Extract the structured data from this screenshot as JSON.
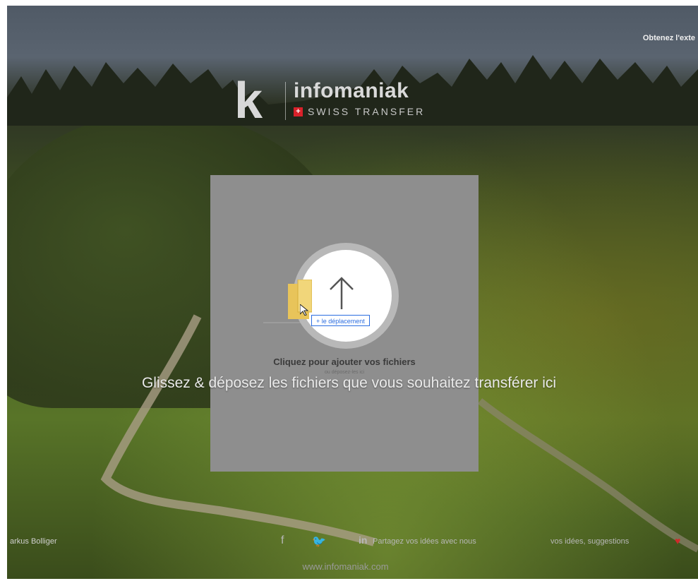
{
  "header": {
    "brand_letter": "k",
    "brand_name": "infomaniak",
    "brand_flag": "+",
    "brand_product": "SWISS TRANSFER",
    "top_right_link": "Obtenez l'exte"
  },
  "upload": {
    "arrow_icon": "upload-arrow-icon",
    "file_icon": "file-icon",
    "drag_chip": "+ le déplacement",
    "title": "Cliquez pour ajouter vos fichiers",
    "subtitle": "ou déposez-les ici"
  },
  "dropzone": {
    "hint": "Glissez & déposez les fichiers que vous souhaitez transférer ici"
  },
  "footer": {
    "credit": "arkus Bolliger",
    "social_icons": [
      "facebook-icon",
      "twitter-icon",
      "linkedin-icon"
    ],
    "link_ideas": "Partagez vos idées avec nous",
    "link_suggestions": "vos idées, suggestions",
    "domain": "www.infomaniak.com"
  },
  "colors": {
    "panel": "#8e8e8e",
    "accent_blue": "#2b6de0",
    "flag_red": "#d9212a",
    "heart_red": "#cf2a2a"
  }
}
